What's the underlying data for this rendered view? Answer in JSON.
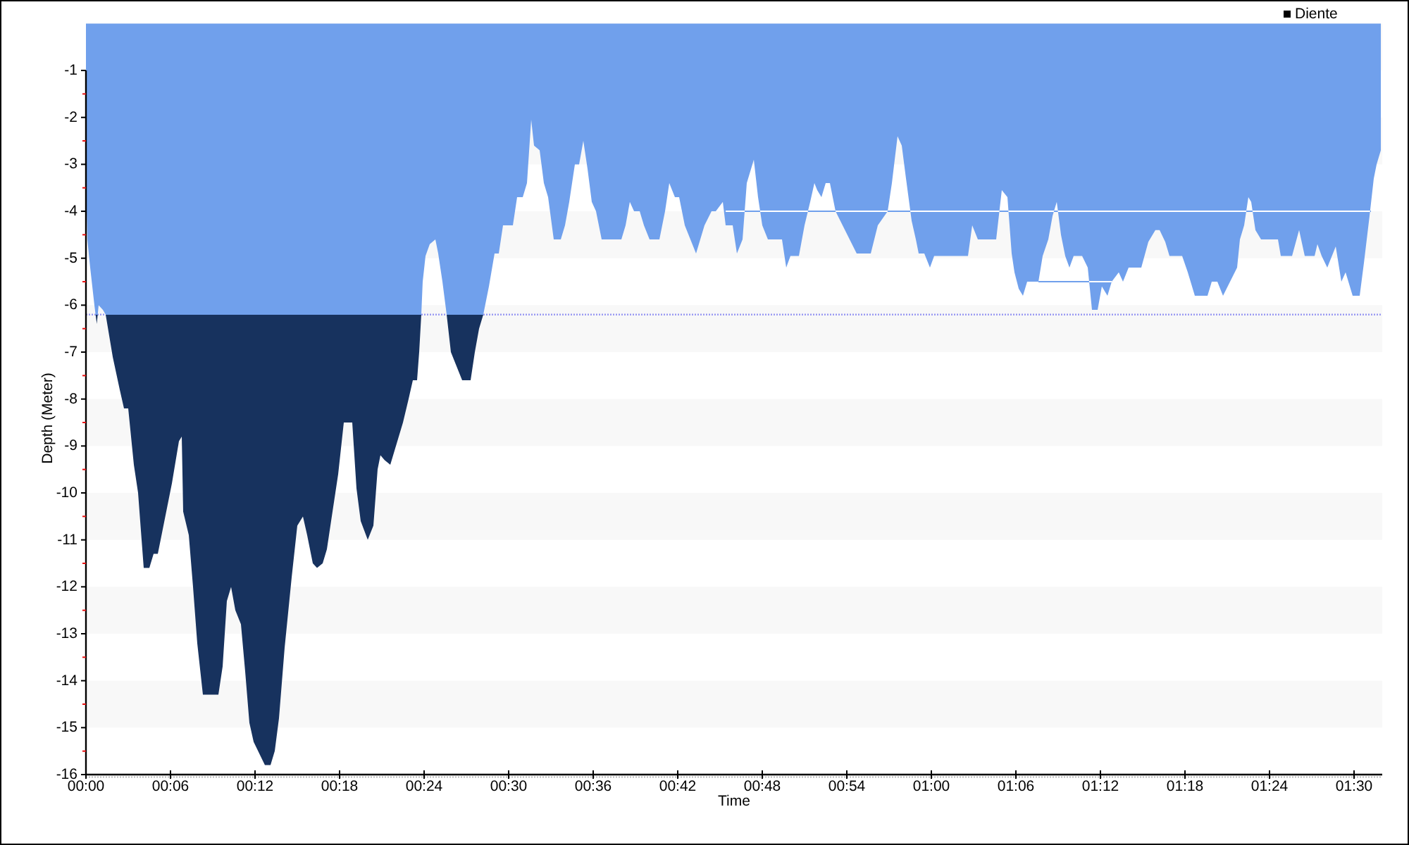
{
  "chart": {
    "chart_data": {
      "type": "area",
      "xlabel": "Time",
      "ylabel": "Depth (Meter)",
      "x": [
        0,
        0.1,
        0.3,
        0.45,
        0.6,
        0.77,
        0.9,
        1.2,
        1.4,
        1.9,
        2.4,
        2.7,
        3.0,
        3.1,
        3.4,
        3.7,
        3.9,
        4.1,
        4.5,
        4.8,
        5.1,
        5.7,
        6.1,
        6.6,
        6.8,
        6.9,
        7.3,
        7.6,
        7.9,
        8.3,
        9.4,
        9.7,
        10.0,
        10.3,
        10.6,
        11.0,
        11.3,
        11.6,
        11.9,
        12.7,
        13.1,
        13.4,
        13.7,
        14.1,
        14.6,
        15.0,
        15.4,
        15.7,
        16.1,
        16.4,
        16.8,
        17.1,
        17.5,
        17.9,
        18.3,
        18.9,
        19.2,
        19.5,
        20.0,
        20.4,
        20.7,
        20.9,
        21.2,
        21.6,
        21.9,
        22.2,
        22.5,
        22.9,
        23.2,
        23.5,
        23.65,
        23.8,
        23.9,
        24.1,
        24.4,
        24.8,
        25.0,
        25.3,
        25.6,
        25.9,
        26.3,
        26.7,
        27.3,
        27.6,
        27.9,
        28.2,
        28.6,
        29.0,
        29.3,
        29.6,
        30.3,
        30.6,
        31.0,
        31.3,
        31.6,
        31.8,
        32.2,
        32.5,
        32.8,
        33.2,
        33.7,
        34.0,
        34.3,
        34.7,
        35.0,
        35.3,
        35.6,
        35.9,
        36.2,
        36.6,
        38.0,
        38.3,
        38.6,
        38.9,
        39.3,
        39.6,
        40.0,
        40.7,
        41.1,
        41.4,
        41.8,
        42.1,
        42.5,
        42.9,
        43.3,
        43.6,
        43.9,
        44.4,
        44.7,
        45.2,
        45.4,
        45.9,
        46.2,
        46.6,
        46.9,
        47.4,
        47.7,
        48.0,
        48.4,
        49.4,
        49.7,
        50.0,
        50.6,
        51.0,
        51.4,
        51.7,
        51.9,
        52.2,
        52.5,
        52.8,
        53.2,
        53.7,
        54.2,
        54.7,
        55.7,
        56.2,
        56.9,
        57.2,
        57.6,
        57.9,
        58.2,
        58.6,
        58.9,
        59.1,
        59.5,
        59.9,
        60.2,
        62.6,
        62.9,
        63.3,
        64.6,
        65.0,
        65.4,
        65.7,
        65.9,
        66.2,
        66.5,
        66.8,
        67.6,
        67.9,
        68.3,
        68.6,
        68.9,
        69.2,
        69.5,
        69.8,
        70.1,
        70.7,
        71.1,
        71.4,
        71.8,
        72.1,
        72.5,
        72.8,
        73.3,
        73.6,
        74.0,
        74.9,
        75.4,
        75.9,
        76.2,
        76.6,
        76.9,
        77.8,
        78.2,
        78.7,
        79.6,
        79.9,
        80.3,
        80.7,
        81.7,
        81.9,
        82.2,
        82.5,
        82.7,
        83.0,
        83.4,
        84.6,
        84.8,
        85.6,
        86.1,
        86.5,
        87.2,
        87.4,
        87.7,
        88.1,
        88.7,
        89.1,
        89.4,
        89.9,
        90.4,
        90.7,
        91.1,
        91.4,
        91.6,
        91.9
      ],
      "series": [
        {
          "name": "Diente",
          "color": "#70a0ec",
          "values": [
            -3.4,
            -4.6,
            -5.2,
            -5.6,
            -6.0,
            -6.4,
            -6.0,
            -6.1,
            -6.2,
            -7.1,
            -7.8,
            -8.2,
            -8.2,
            -8.5,
            -9.4,
            -10.0,
            -10.8,
            -11.6,
            -11.6,
            -11.3,
            -11.3,
            -10.4,
            -9.8,
            -8.9,
            -8.8,
            -10.4,
            -10.9,
            -12.0,
            -13.2,
            -14.3,
            -14.3,
            -13.7,
            -12.3,
            -12.0,
            -12.5,
            -12.8,
            -13.8,
            -14.9,
            -15.3,
            -15.8,
            -15.8,
            -15.5,
            -14.8,
            -13.3,
            -11.8,
            -10.7,
            -10.5,
            -10.9,
            -11.5,
            -11.6,
            -11.5,
            -11.2,
            -10.4,
            -9.6,
            -8.5,
            -8.5,
            -9.9,
            -10.6,
            -11.0,
            -10.7,
            -9.5,
            -9.2,
            -9.3,
            -9.4,
            -9.1,
            -8.8,
            -8.5,
            -8.0,
            -7.6,
            -7.6,
            -7.0,
            -6.2,
            -5.5,
            -4.95,
            -4.7,
            -4.6,
            -4.9,
            -5.5,
            -6.2,
            -7.0,
            -7.3,
            -7.6,
            -7.6,
            -7.0,
            -6.5,
            -6.2,
            -5.6,
            -4.9,
            -4.9,
            -4.3,
            -4.3,
            -3.7,
            -3.7,
            -3.4,
            -2.05,
            -2.6,
            -2.7,
            -3.4,
            -3.7,
            -4.6,
            -4.6,
            -4.3,
            -3.8,
            -3.0,
            -3.0,
            -2.5,
            -3.1,
            -3.8,
            -4.0,
            -4.6,
            -4.6,
            -4.3,
            -3.8,
            -4.0,
            -4.0,
            -4.3,
            -4.6,
            -4.6,
            -4.0,
            -3.4,
            -3.7,
            -3.7,
            -4.3,
            -4.6,
            -4.9,
            -4.6,
            -4.3,
            -4.0,
            -4.0,
            -3.8,
            -4.3,
            -4.3,
            -4.9,
            -4.6,
            -3.4,
            -2.9,
            -3.7,
            -4.3,
            -4.6,
            -4.6,
            -5.2,
            -4.95,
            -4.95,
            -4.3,
            -3.8,
            -3.4,
            -3.55,
            -3.7,
            -3.4,
            -3.4,
            -4.0,
            -4.3,
            -4.6,
            -4.9,
            -4.9,
            -4.3,
            -4.0,
            -3.4,
            -2.4,
            -2.6,
            -3.3,
            -4.2,
            -4.6,
            -4.9,
            -4.9,
            -5.2,
            -4.95,
            -4.95,
            -4.3,
            -4.6,
            -4.6,
            -3.55,
            -3.7,
            -4.9,
            -5.3,
            -5.65,
            -5.8,
            -5.5,
            -5.5,
            -4.95,
            -4.6,
            -4.1,
            -3.8,
            -4.5,
            -4.95,
            -5.2,
            -4.95,
            -4.95,
            -5.2,
            -6.1,
            -6.1,
            -5.6,
            -5.8,
            -5.5,
            -5.3,
            -5.5,
            -5.2,
            -5.2,
            -4.65,
            -4.4,
            -4.4,
            -4.65,
            -4.95,
            -4.95,
            -5.3,
            -5.8,
            -5.8,
            -5.5,
            -5.5,
            -5.8,
            -5.2,
            -4.6,
            -4.3,
            -3.7,
            -3.8,
            -4.4,
            -4.6,
            -4.6,
            -4.95,
            -4.95,
            -4.4,
            -4.95,
            -4.95,
            -4.7,
            -4.95,
            -5.2,
            -4.75,
            -5.5,
            -5.3,
            -5.8,
            -5.8,
            -5.1,
            -4.1,
            -3.3,
            -3.0,
            -2.7
          ]
        }
      ],
      "xlim": [
        0,
        92
      ],
      "ylim": [
        -16,
        0
      ],
      "xticks": [
        {
          "value": 0,
          "label": "00:00"
        },
        {
          "value": 6,
          "label": "00:06"
        },
        {
          "value": 12,
          "label": "00:12"
        },
        {
          "value": 18,
          "label": "00:18"
        },
        {
          "value": 24,
          "label": "00:24"
        },
        {
          "value": 30,
          "label": "00:30"
        },
        {
          "value": 36,
          "label": "00:36"
        },
        {
          "value": 42,
          "label": "00:42"
        },
        {
          "value": 48,
          "label": "00:48"
        },
        {
          "value": 54,
          "label": "00:54"
        },
        {
          "value": 60,
          "label": "01:00"
        },
        {
          "value": 66,
          "label": "01:06"
        },
        {
          "value": 72,
          "label": "01:12"
        },
        {
          "value": 78,
          "label": "01:18"
        },
        {
          "value": 84,
          "label": "01:24"
        },
        {
          "value": 90,
          "label": "01:30"
        }
      ],
      "yticks": [
        -1,
        -2,
        -3,
        -4,
        -5,
        -6,
        -7,
        -8,
        -9,
        -10,
        -11,
        -12,
        -13,
        -14,
        -15,
        -16
      ],
      "ref_lines": [
        {
          "axis": "y",
          "value": -6.2
        }
      ]
    }
  }
}
